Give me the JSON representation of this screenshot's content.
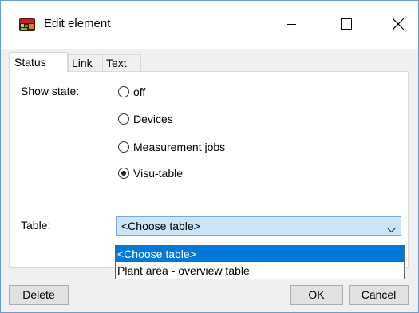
{
  "window": {
    "title": "Edit element",
    "icon": "app-icon",
    "controls": [
      "minimize-icon",
      "maximize-icon",
      "close-icon"
    ]
  },
  "tabs": [
    {
      "label": "Status",
      "active": true
    },
    {
      "label": "Link",
      "active": false
    },
    {
      "label": "Text",
      "active": false
    }
  ],
  "status": {
    "show_state_label": "Show state:",
    "options": [
      {
        "label": "off",
        "checked": false
      },
      {
        "label": "Devices",
        "checked": false
      },
      {
        "label": "Measurement jobs",
        "checked": false
      },
      {
        "label": "Visu-table",
        "checked": true
      }
    ],
    "table_label": "Table:",
    "table_value": "<Choose table>",
    "table_options": [
      "<Choose table>",
      "Plant area - overview table"
    ],
    "highlighted_option": "<Choose table>"
  },
  "buttons": {
    "delete": "Delete",
    "ok": "OK",
    "cancel": "Cancel"
  },
  "colors": {
    "selection": "#0078d7",
    "combo_focus_bg": "#cce4f7",
    "combo_border": "#7aa7d8"
  }
}
